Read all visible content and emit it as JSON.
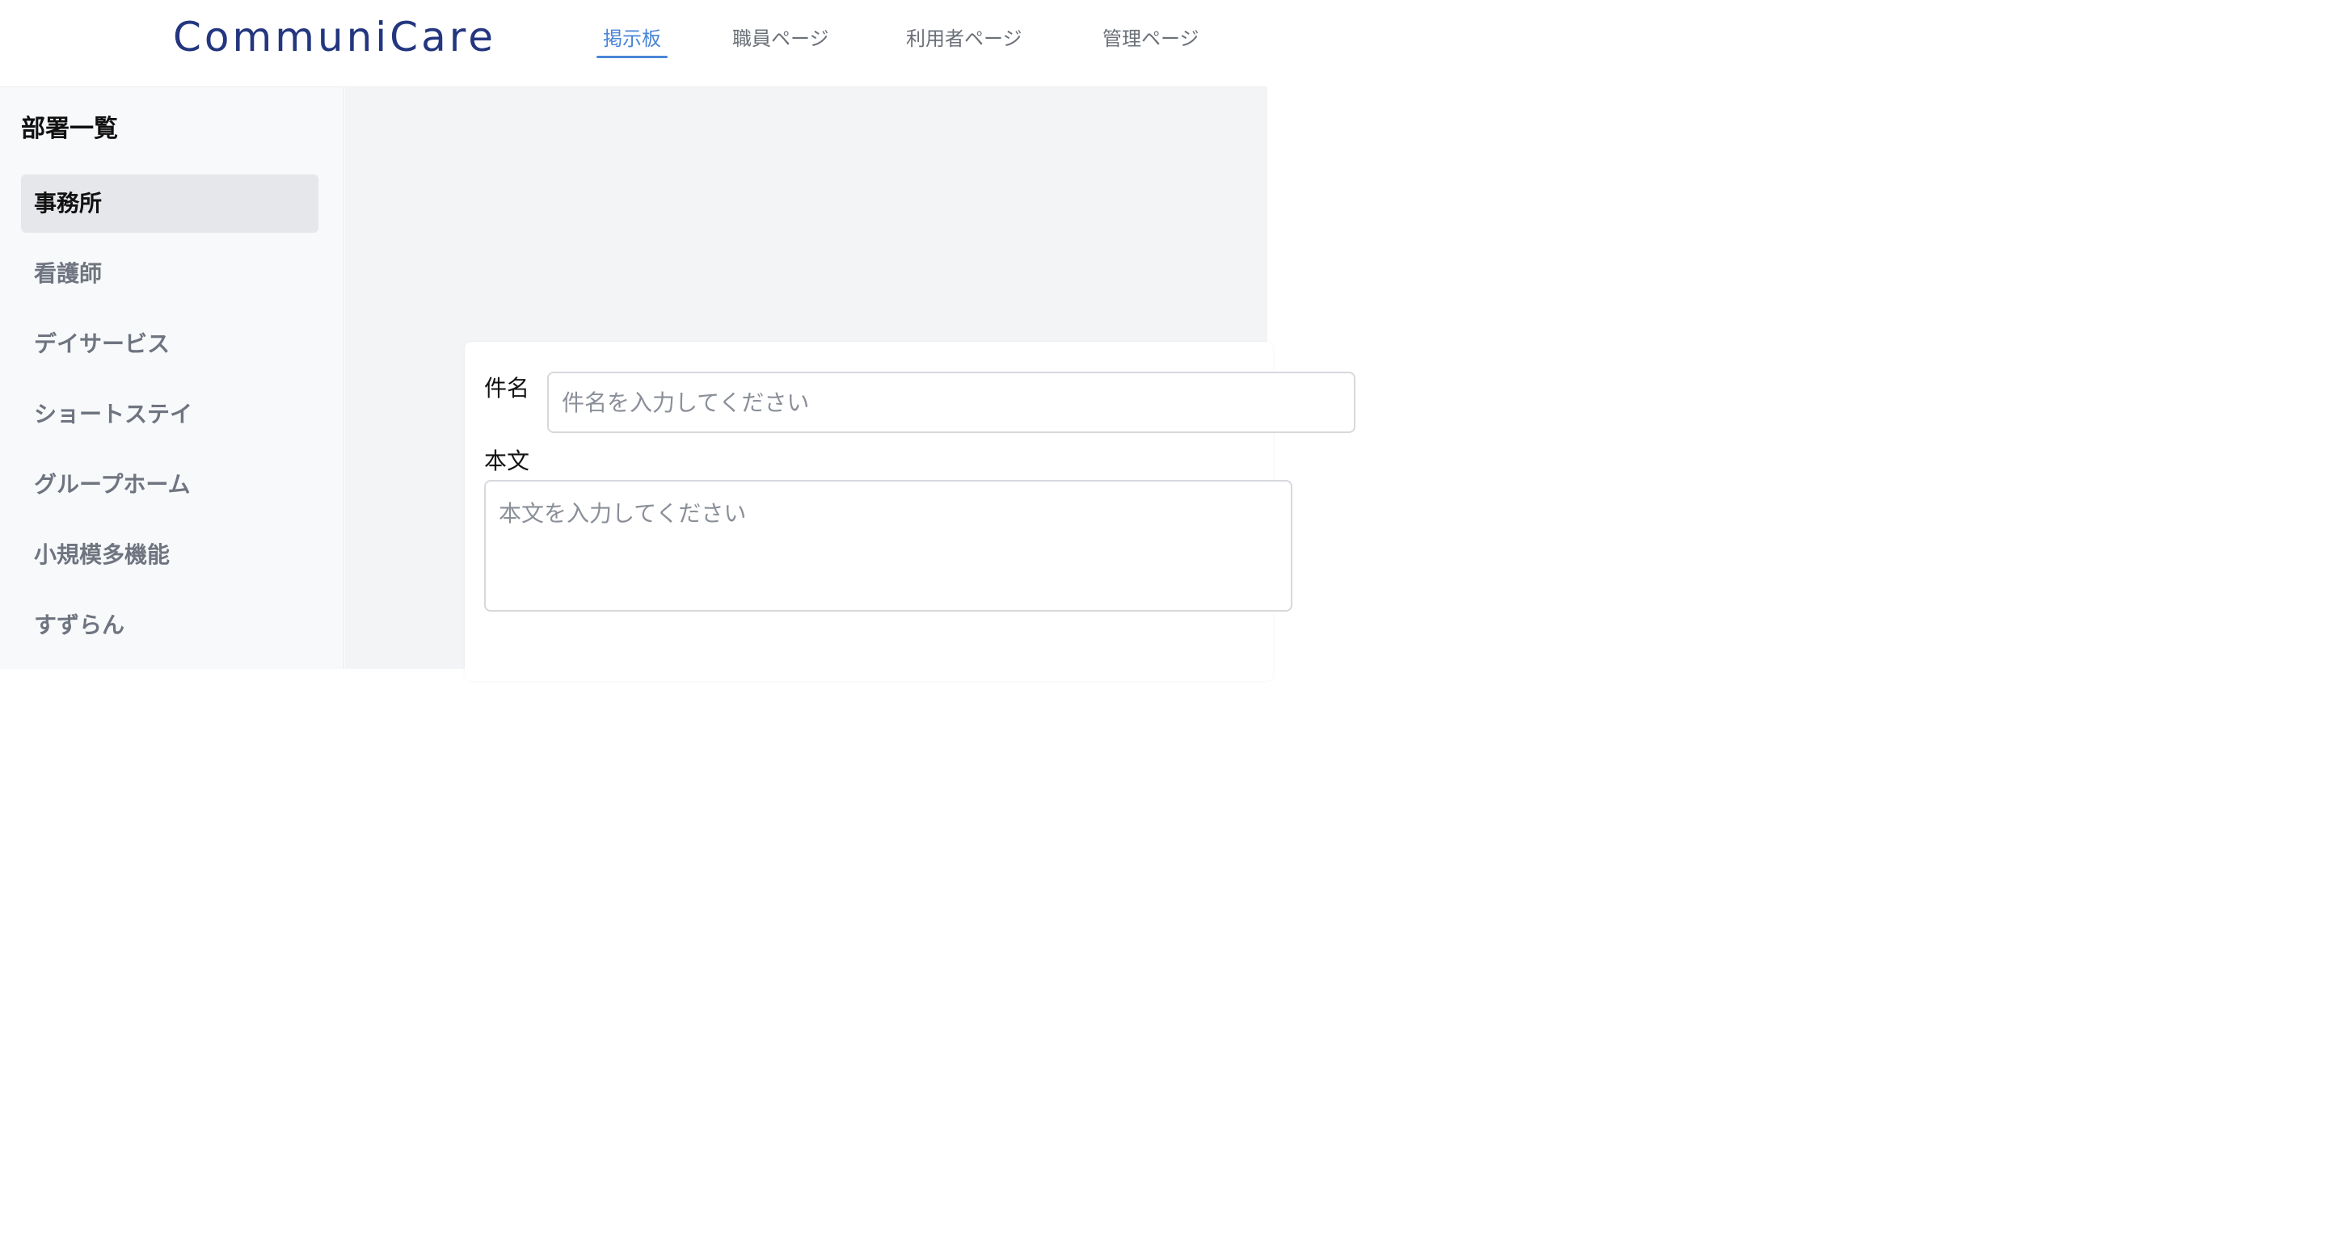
{
  "header": {
    "logo": "CommuniCare",
    "nav": [
      {
        "label": "掲示板",
        "active": true
      },
      {
        "label": "職員ページ",
        "active": false
      },
      {
        "label": "利用者ページ",
        "active": false
      },
      {
        "label": "管理ページ",
        "active": false
      }
    ]
  },
  "sidebar": {
    "title": "部署一覧",
    "items": [
      {
        "label": "事務所",
        "selected": true
      },
      {
        "label": "看護師",
        "selected": false
      },
      {
        "label": "デイサービス",
        "selected": false
      },
      {
        "label": "ショートステイ",
        "selected": false
      },
      {
        "label": "グループホーム",
        "selected": false
      },
      {
        "label": "小規模多機能",
        "selected": false
      },
      {
        "label": "すずらん",
        "selected": false
      }
    ]
  },
  "form": {
    "subject_label": "件名",
    "subject_placeholder": "件名を入力してください",
    "subject_value": "",
    "body_label": "本文",
    "body_placeholder": "本文を入力してください",
    "body_value": ""
  },
  "colors": {
    "brand": "#23367f",
    "accent": "#4a86d6",
    "selected_bg": "#e6e7ea"
  }
}
